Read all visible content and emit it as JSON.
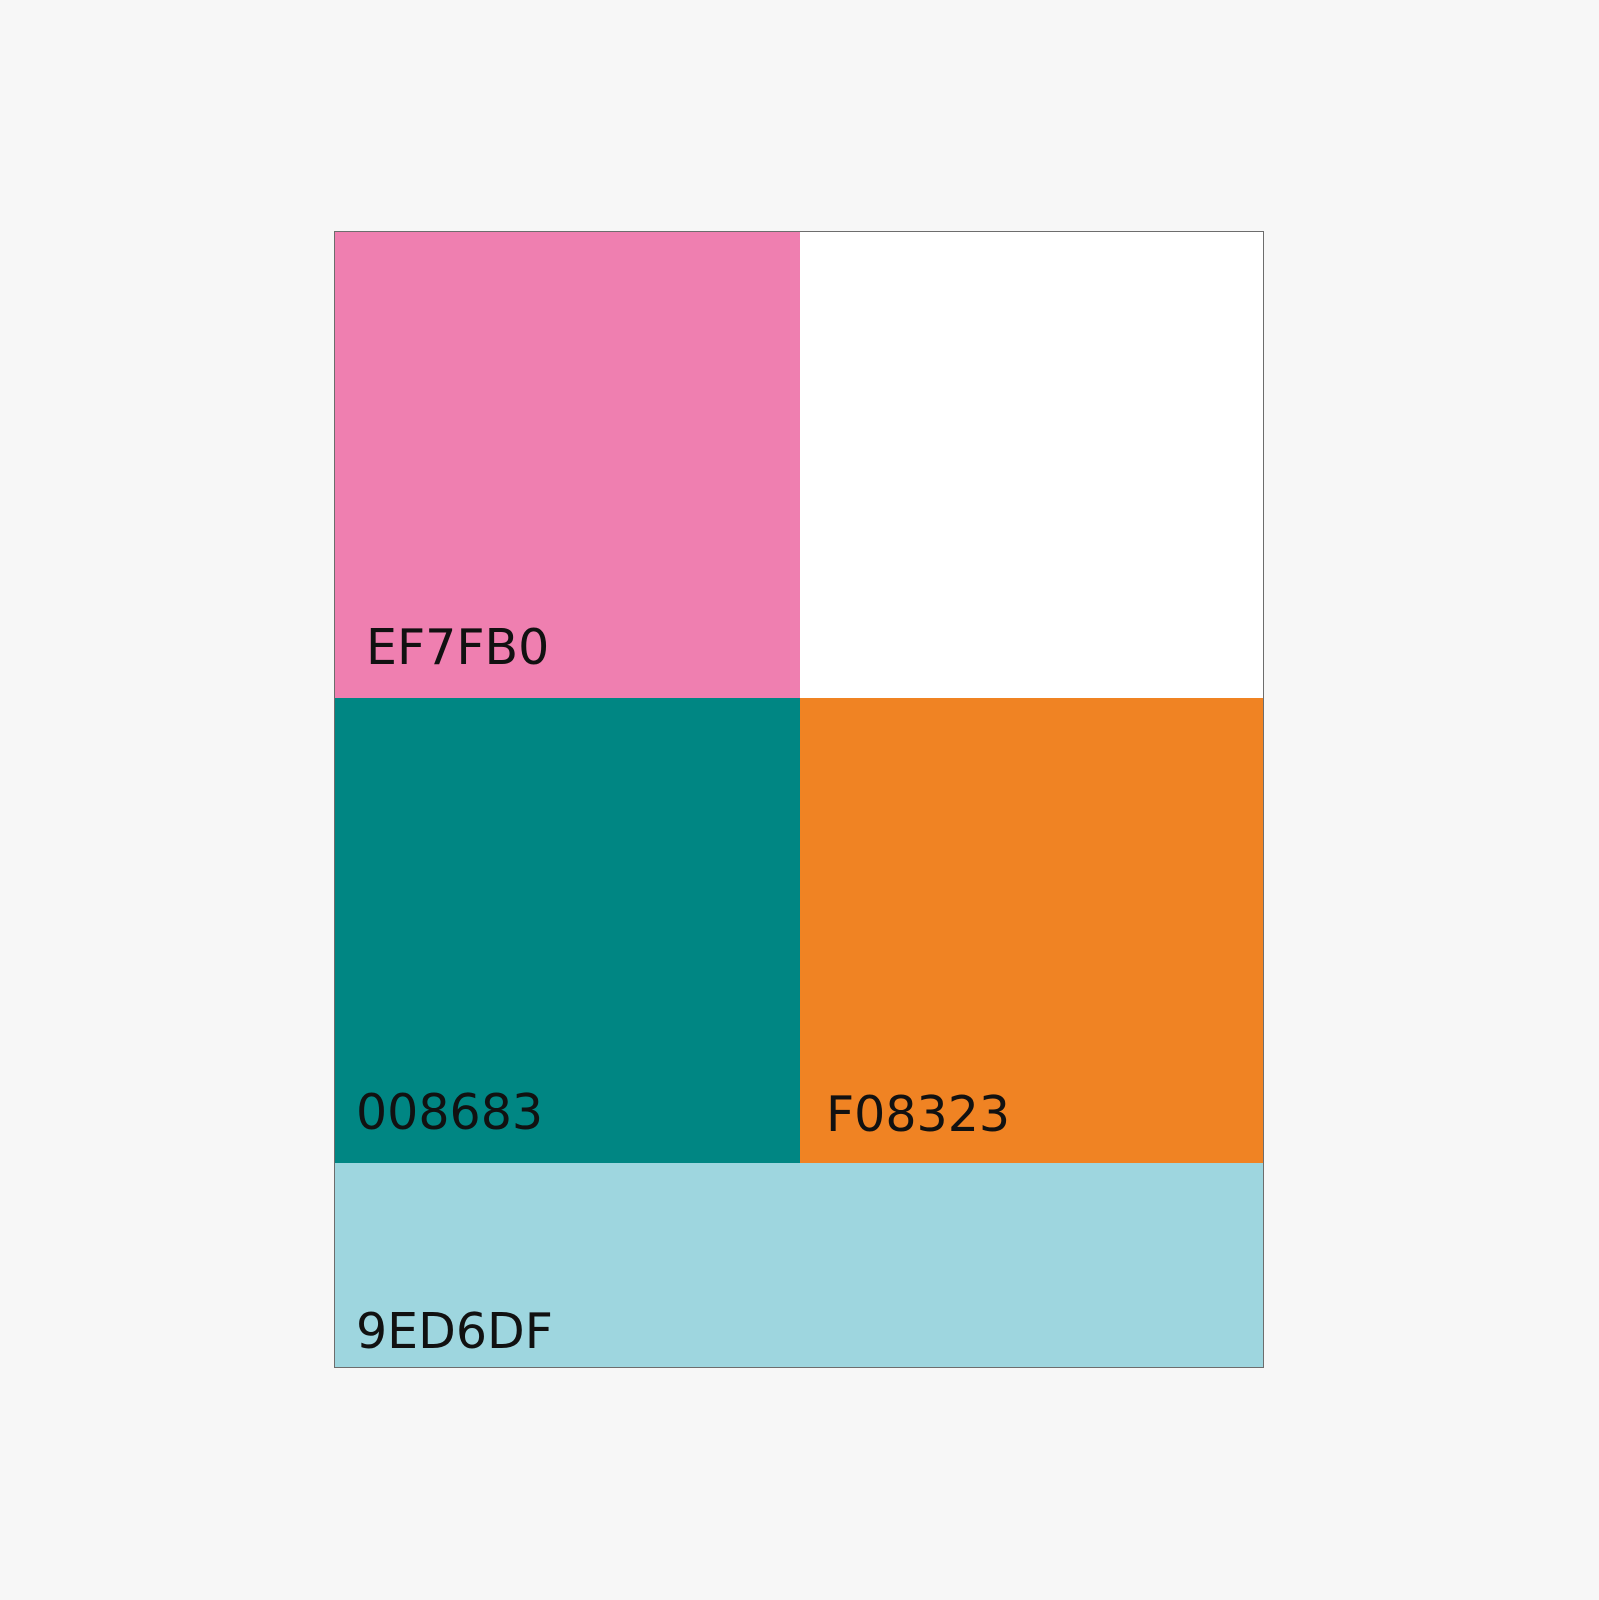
{
  "swatches": [
    {
      "id": "pink",
      "color": "#EF7FB0",
      "label": "EF7FB0"
    },
    {
      "id": "white",
      "color": "#FFFFFF",
      "label": ""
    },
    {
      "id": "teal",
      "color": "#008683",
      "label": "008683"
    },
    {
      "id": "orange",
      "color": "#F08323",
      "label": "F08323"
    },
    {
      "id": "blue",
      "color": "#9ED6DF",
      "label": "9ED6DF"
    }
  ]
}
